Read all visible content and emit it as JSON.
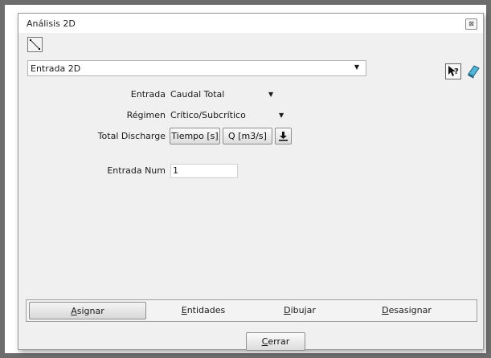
{
  "window": {
    "title": "Análisis 2D",
    "close_glyph": "⊠"
  },
  "entity_selector": {
    "value": "Entrada 2D"
  },
  "toolbar": {
    "select_tool_icon": "line-select-icon",
    "help_icon": "pointer-help-icon",
    "eraser_icon": "eraser-icon"
  },
  "form": {
    "entrada": {
      "label": "Entrada",
      "value": "Caudal Total"
    },
    "regimen": {
      "label": "Régimen",
      "value": "Crítico/Subcrítico"
    },
    "total_discharge": {
      "label": "Total Discharge",
      "time_button": "Tiempo [s]",
      "flow_button": "Q [m3/s]",
      "import_icon": "download-icon"
    },
    "entrada_num": {
      "label": "Entrada Num",
      "value": "1"
    }
  },
  "tabs": [
    {
      "first": "A",
      "rest": "signar",
      "active": true
    },
    {
      "first": "E",
      "rest": "ntidades",
      "active": false
    },
    {
      "first": "D",
      "rest": "ibujar",
      "active": false
    },
    {
      "first": "D",
      "rest": "esasignar",
      "active": false
    }
  ],
  "footer": {
    "close_first": "C",
    "close_rest": "errar"
  }
}
